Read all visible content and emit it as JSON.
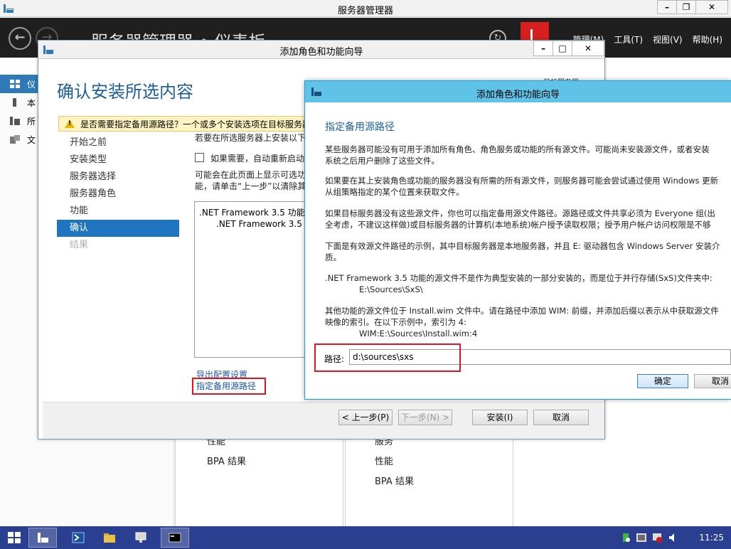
{
  "server_manager": {
    "title": "服务器管理器",
    "breadcrumb": "服务器管理器 • 仪表板",
    "menu": [
      "管理(M)",
      "工具(T)",
      "视图(V)",
      "帮助(H)"
    ],
    "sidebar": [
      "仪",
      "本",
      "所",
      "文"
    ],
    "tiles": {
      "left": [
        "性能",
        "BPA 结果"
      ],
      "right": [
        "服务",
        "性能",
        "BPA 结果"
      ]
    }
  },
  "wizard": {
    "title": "添加角色和功能向导",
    "heading": "确认安装所选内容",
    "target_label": "目标服务器",
    "warning": "是否需要指定备用源路径？一个或多个安装选项在目标服务器",
    "nav": [
      "开始之前",
      "安装类型",
      "服务器选择",
      "服务器角色",
      "功能",
      "确认",
      "结果"
    ],
    "body_line1": "若要在所选服务器上安装以下",
    "checkbox_label": "如果需要，自动重新启动",
    "body_line2": "可能会在此页面上显示可选功",
    "body_line3": "能，请单击“上一步”以清除其",
    "features": [
      ".NET Framework 3.5 功能",
      ".NET Framework 3.5 ("
    ],
    "export_link": "导出配置设置",
    "alt_source_link": "指定备用源路径",
    "buttons": {
      "prev": "< 上一步(P)",
      "next": "下一步(N) >",
      "install": "安装(I)",
      "cancel": "取消"
    }
  },
  "dialog": {
    "title": "添加角色和功能向导",
    "heading": "指定备用源路径",
    "p1a": "某些服务器可能没有可用于添加所有角色、角色服务或功能的所有源文件。可能尚未安装源文件，或者安装",
    "p1b": "系统之后用户删除了这些文件。",
    "p2a": "如果要在其上安装角色或功能的服务器没有所需的所有源文件，则服务器可能会尝试通过使用 Windows 更新",
    "p2b": "从组策略指定的某个位置来获取文件。",
    "p3a": "如果目标服务器没有这些源文件，你也可以指定备用源文件路径。源路径或文件共享必须为 Everyone 组(出",
    "p3b": "全考虑，不建议这样做)或目标服务器的计算机(本地系统)帐户授予读取权限；授予用户帐户访问权限是不够",
    "p4a": "下面是有效源文件路径的示例，其中目标服务器是本地服务器，并且 E: 驱动器包含 Windows Server 安装介",
    "p4b": "质。",
    "p5a": ".NET Framework 3.5 功能的源文件不是作为典型安装的一部分安装的，而是位于并行存储(SxS)文件夹中:",
    "p5b": "E:\\Sources\\SxS\\",
    "p6a": "其他功能的源文件位于 Install.wim 文件中。请在路径中添加 WIM: 前缀，并添加后缀以表示从中获取源文件",
    "p6b": "映像的索引。在以下示例中，索引为 4:",
    "p6c": "WIM:E:\\Sources\\Install.wim:4",
    "path_label": "路径:",
    "path_value": "d:\\sources\\sxs",
    "ok": "确定",
    "cancel": "取消"
  },
  "taskbar": {
    "clock": "11:25"
  },
  "colors": {
    "accent": "#2e7ab8",
    "dialog_title": "#5fc3e8",
    "highlight_box": "#e0151d",
    "taskbar": "#2a3f8f"
  }
}
